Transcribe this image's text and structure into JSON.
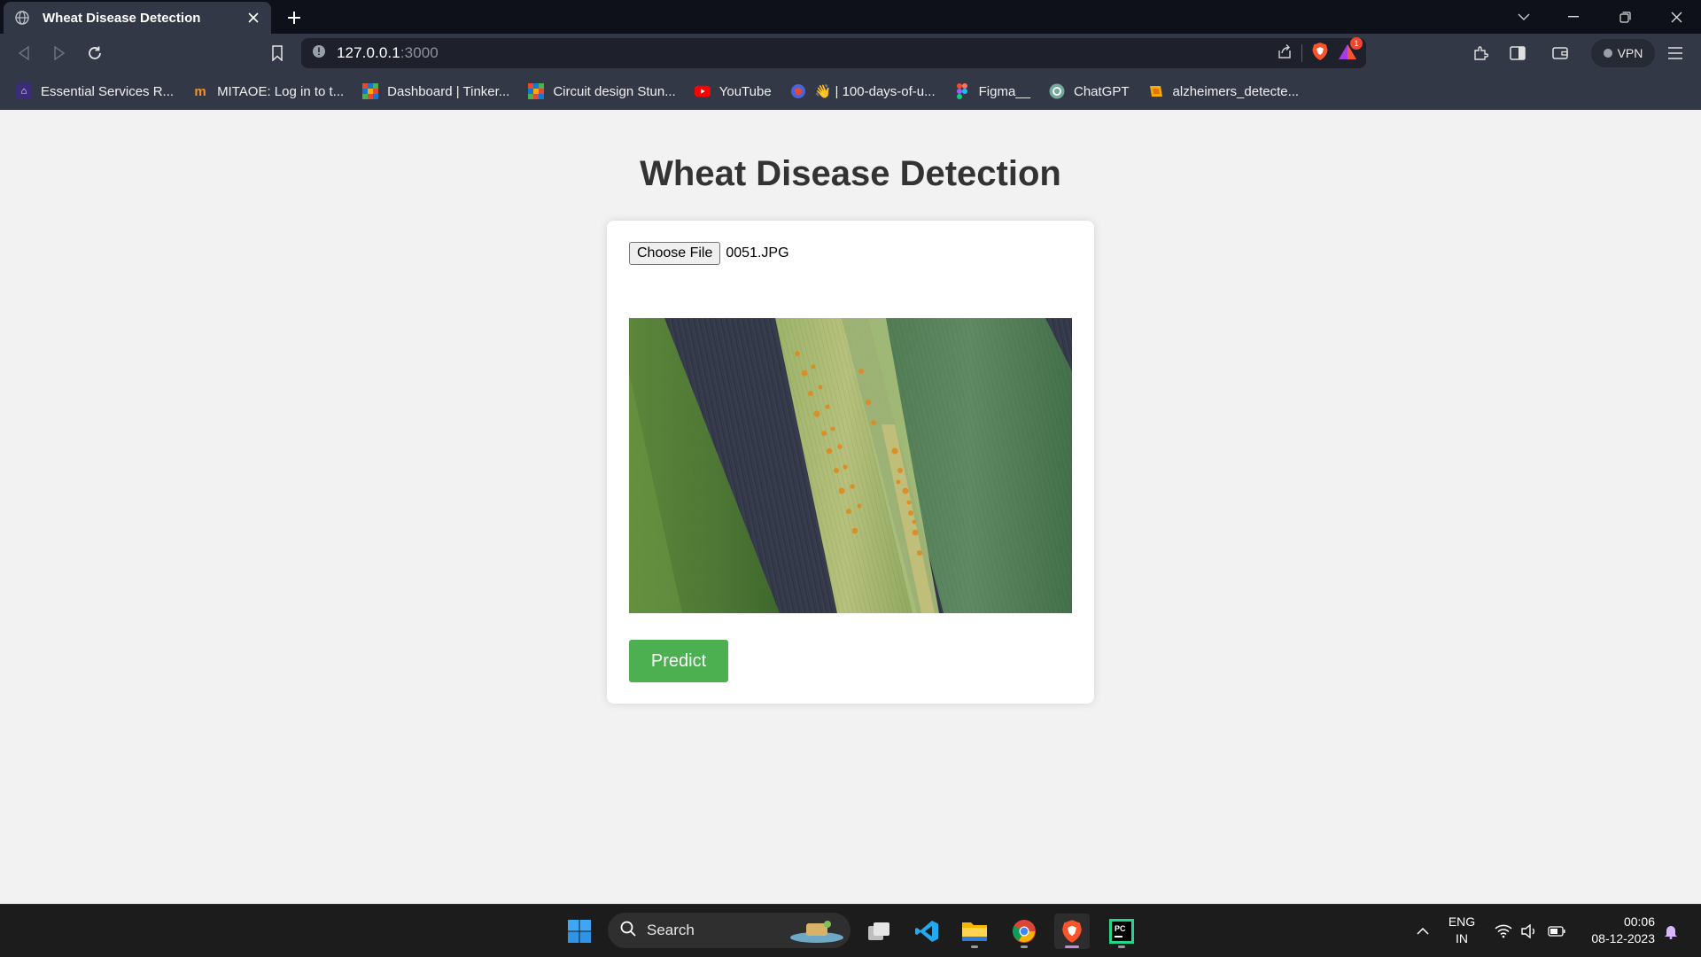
{
  "browser": {
    "tab": {
      "title": "Wheat Disease Detection",
      "favicon": "globe-icon"
    },
    "url": {
      "host": "127.0.0.1",
      "port": ":3000"
    },
    "vpn_label": "VPN",
    "brave_badge": "1"
  },
  "bookmarks": [
    {
      "label": "Essential Services R...",
      "icon": "university-icon",
      "color": "#3b2c7a"
    },
    {
      "label": "MITAOE: Log in to t...",
      "icon": "moodle-icon",
      "color": "#f7931e"
    },
    {
      "label": "Dashboard | Tinker...",
      "icon": "tinkercad-icon",
      "color": "#1477d1"
    },
    {
      "label": "Circuit design Stun...",
      "icon": "tinkercad-icon",
      "color": "#1477d1"
    },
    {
      "label": "YouTube",
      "icon": "youtube-icon",
      "color": "#ff0000"
    },
    {
      "label": "",
      "icon": "github-copilot-icon",
      "color": "#6e40c9"
    },
    {
      "label": "👋 | 100-days-of-u...",
      "icon": "wave-icon",
      "color": "#333847"
    },
    {
      "label": "Figma__",
      "icon": "figma-icon",
      "color": "#a259ff"
    },
    {
      "label": "ChatGPT",
      "icon": "chatgpt-icon",
      "color": "#74aa9c"
    },
    {
      "label": "alzheimers_detecte...",
      "icon": "colab-icon",
      "color": "#f9ab00"
    }
  ],
  "page": {
    "heading": "Wheat Disease Detection",
    "file_button": "Choose File",
    "file_name": "0051.JPG",
    "preview_alt": "wheat-leaf-rust-photo",
    "predict_label": "Predict",
    "accent": "#4caf50"
  },
  "taskbar": {
    "search_label": "Search",
    "lang_line1": "ENG",
    "lang_line2": "IN",
    "time": "00:06",
    "date": "08-12-2023"
  }
}
